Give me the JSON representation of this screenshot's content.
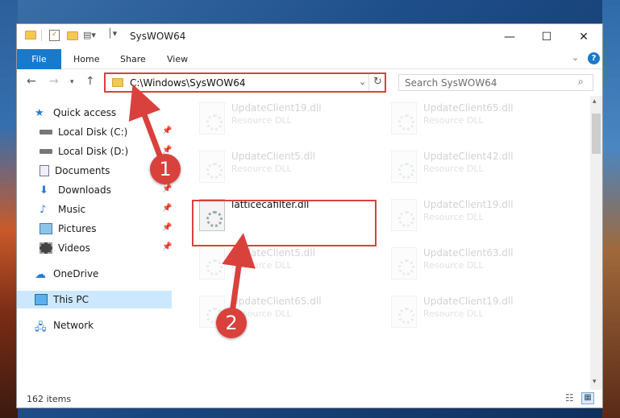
{
  "window": {
    "title": "SysWOW64",
    "minimize": "—",
    "maximize": "☐",
    "close": "✕"
  },
  "ribbon": {
    "file": "File",
    "tabs": [
      "Home",
      "Share",
      "View"
    ],
    "help": "?"
  },
  "address": {
    "path": "C:\\Windows\\SysWOW64",
    "search_placeholder": "Search SysWOW64"
  },
  "nav": {
    "items": [
      {
        "label": "Quick access",
        "icon": "star-icon"
      },
      {
        "label": "Local Disk (C:)",
        "icon": "drive-icon",
        "pinned": true
      },
      {
        "label": "Local Disk (D:)",
        "icon": "drive-icon",
        "pinned": true
      },
      {
        "label": "Documents",
        "icon": "documents-icon",
        "pinned": true
      },
      {
        "label": "Downloads",
        "icon": "download-icon",
        "pinned": true
      },
      {
        "label": "Music",
        "icon": "music-icon",
        "pinned": true
      },
      {
        "label": "Pictures",
        "icon": "pictures-icon",
        "pinned": true
      },
      {
        "label": "Videos",
        "icon": "videos-icon",
        "pinned": true
      },
      {
        "label": "OneDrive",
        "icon": "cloud-icon"
      },
      {
        "label": "This PC",
        "icon": "pc-icon"
      },
      {
        "label": "Network",
        "icon": "network-icon"
      }
    ]
  },
  "files": {
    "col1": [
      {
        "name": "UpdateClient19.dll",
        "type": "Resource DLL"
      },
      {
        "name": "UpdateClient5.dll",
        "type": "Resource DLL"
      },
      {
        "name": "latticecafilter.dll",
        "type": ""
      },
      {
        "name": "UpdateClient5.dll",
        "type": "Resource DLL"
      },
      {
        "name": "UpdateClient65.dll",
        "type": "Resource DLL"
      }
    ],
    "col2": [
      {
        "name": "UpdateClient65.dll",
        "type": "Resource DLL"
      },
      {
        "name": "UpdateClient42.dll",
        "type": "Resource DLL"
      },
      {
        "name": "UpdateClient19.dll",
        "type": "Resource DLL"
      },
      {
        "name": "UpdateClient63.dll",
        "type": "Resource DLL"
      },
      {
        "name": "UpdateClient19.dll",
        "type": "Resource DLL"
      }
    ]
  },
  "status": {
    "count": "162 items"
  },
  "annotations": {
    "step1": "1",
    "step2": "2",
    "color": "#d9413d"
  }
}
